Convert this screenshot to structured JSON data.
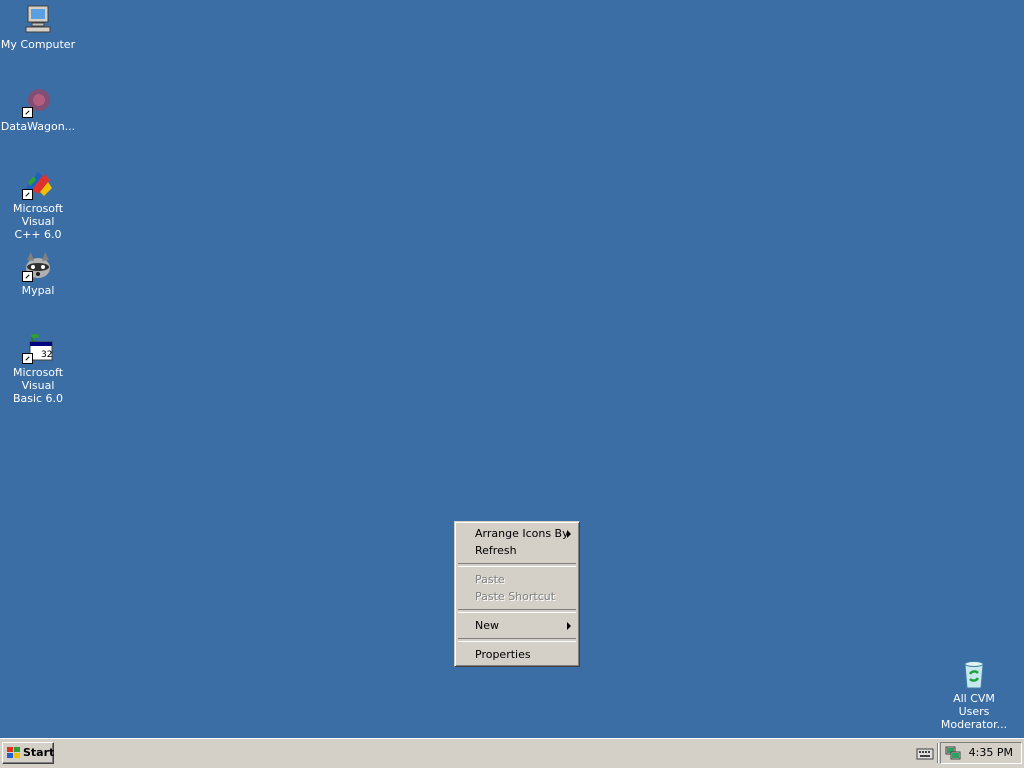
{
  "desktop": {
    "background_color": "#3a6ea5",
    "icons": [
      {
        "label": "My Computer",
        "icon": "my-computer-icon",
        "shortcut": false
      },
      {
        "label": "DataWagon...",
        "icon": "datawagon-icon",
        "shortcut": true
      },
      {
        "label": "Microsoft Visual\nC++ 6.0",
        "icon": "visual-cpp-icon",
        "shortcut": true
      },
      {
        "label": "Mypal",
        "icon": "mypal-raccoon-icon",
        "shortcut": true
      },
      {
        "label": "Microsoft Visual\nBasic 6.0",
        "icon": "visual-basic-icon",
        "shortcut": true
      },
      {
        "label": "All CVM Users\nModerator...",
        "icon": "recycle-bin-icon",
        "shortcut": false
      }
    ]
  },
  "context_menu": {
    "items": [
      {
        "label": "Arrange Icons By",
        "enabled": true,
        "submenu": true
      },
      {
        "label": "Refresh",
        "enabled": true,
        "submenu": false
      },
      {
        "label": "Paste",
        "enabled": false,
        "submenu": false
      },
      {
        "label": "Paste Shortcut",
        "enabled": false,
        "submenu": false
      },
      {
        "label": "New",
        "enabled": true,
        "submenu": true
      },
      {
        "label": "Properties",
        "enabled": true,
        "submenu": false
      }
    ]
  },
  "taskbar": {
    "start_label": "Start",
    "clock": "4:35 PM",
    "tray_icons": [
      "keyboard-icon",
      "network-icon"
    ]
  }
}
